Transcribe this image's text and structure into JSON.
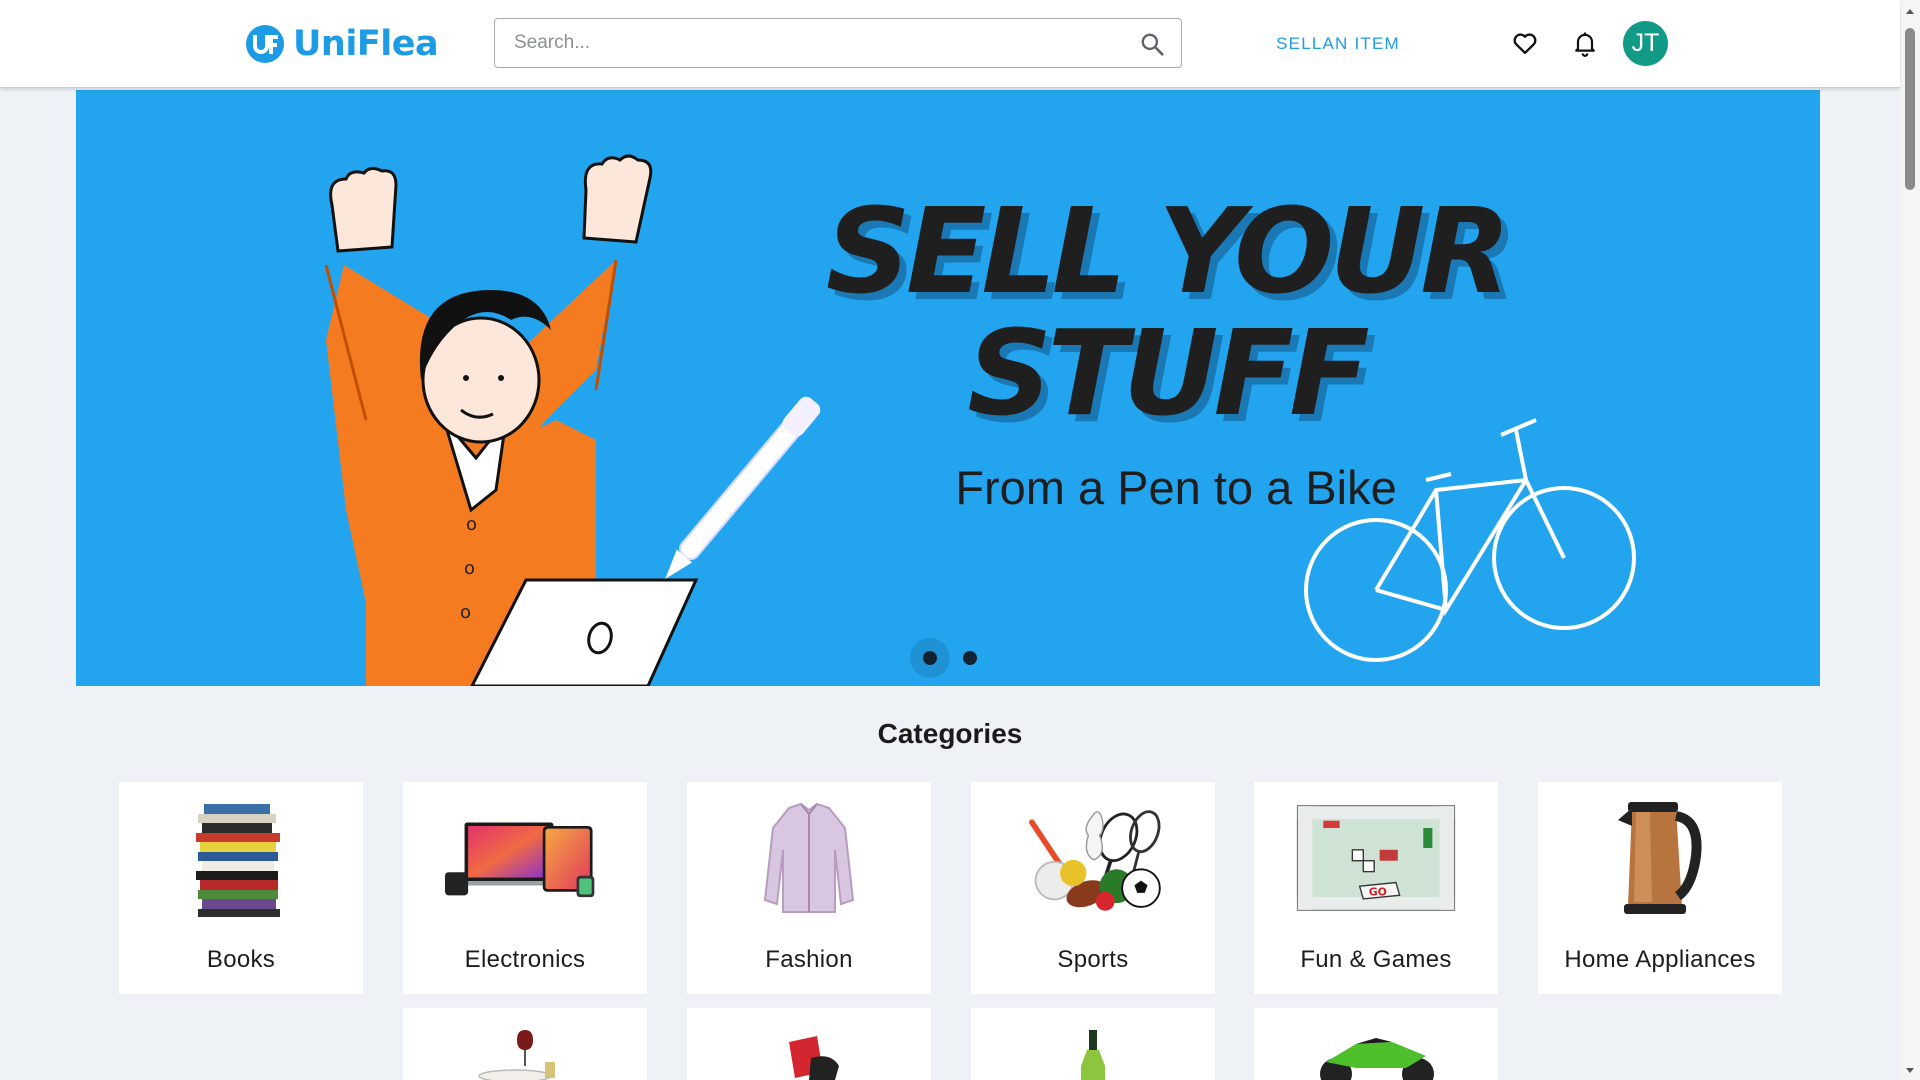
{
  "header": {
    "brand": "UniFlea",
    "logo_mark": "UF",
    "search_placeholder": "Search...",
    "sell_label": "SELLAN ITEM",
    "wishlist_icon": "heart-icon",
    "notifications_icon": "bell-icon",
    "avatar_initials": "JT"
  },
  "banner": {
    "title_line1": "SELL YOUR",
    "title_line2": "STUFF",
    "subtitle": "From a Pen to a Bike",
    "slides": 2,
    "active_slide": 1
  },
  "categories": {
    "title": "Categories",
    "items": [
      {
        "label": "Books",
        "icon": "books-stack"
      },
      {
        "label": "Electronics",
        "icon": "devices"
      },
      {
        "label": "Fashion",
        "icon": "jacket"
      },
      {
        "label": "Sports",
        "icon": "sports-balls"
      },
      {
        "label": "Fun & Games",
        "icon": "board-game"
      },
      {
        "label": "Home Appliances",
        "icon": "kettle"
      }
    ],
    "second_row_icons": [
      "dining-table",
      "office-chair",
      "bottle",
      "motorbike"
    ]
  },
  "colors": {
    "brand": "#1d9be5",
    "banner_bg": "#22a5ee",
    "avatar_bg": "#119b86",
    "page_bg": "#eef2f6",
    "shirt": "#f47b20"
  }
}
